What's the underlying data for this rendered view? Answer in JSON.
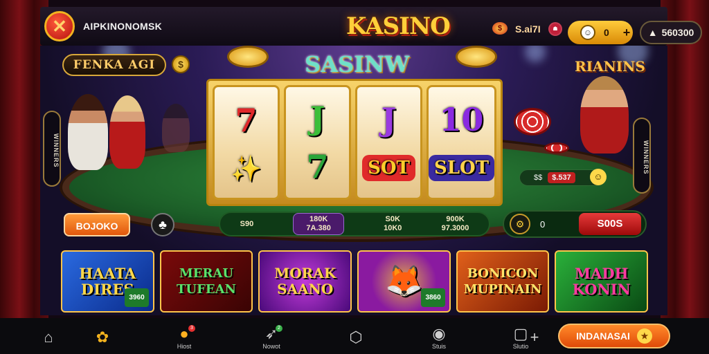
{
  "header": {
    "app_name": "AIPKINONOMSK",
    "brand": "KASINO",
    "slot_value": "S.ai7I",
    "coins_value": "0",
    "coins_plus": "+",
    "balance": "560300",
    "balance_icon": "wallet-icon"
  },
  "stage": {
    "title_label": "FENKA AGI",
    "reel_title": "SASINW",
    "winners_label": "RIANINS",
    "left_pill": "WINNERS",
    "right_pill": "WINNERS",
    "reels": [
      {
        "top": "7",
        "bottom": "✨"
      },
      {
        "top": "J",
        "bottom": "7"
      },
      {
        "top": "J",
        "bottom": "SOT"
      },
      {
        "top": "10",
        "bottom": "SLOT"
      }
    ],
    "dealer_pill_prefix": "$$",
    "dealer_pill_amount": "$.537",
    "bet_button": "BOJOKO",
    "info_cells": [
      {
        "line1": "S90",
        "line2": ""
      },
      {
        "line1": "180K",
        "line2": "7A.380"
      },
      {
        "line1": "S0K",
        "line2": "10K0"
      },
      {
        "line1": "900K",
        "line2": "97.3000"
      }
    ],
    "spin_value": "0",
    "spin_button": "S00S"
  },
  "games": [
    {
      "title": "HAATA DIRES",
      "badge": "3960"
    },
    {
      "title": "MERAU TUFEAN",
      "badge": ""
    },
    {
      "title": "MORAK SAANO",
      "badge": ""
    },
    {
      "title": "",
      "badge": "3860"
    },
    {
      "title": "BONICON MUPINAIN",
      "badge": ""
    },
    {
      "title": "MADH KONIN",
      "badge": ""
    }
  ],
  "bottom_nav": [
    {
      "label": "",
      "icon": "home-icon"
    },
    {
      "label": "",
      "icon": "puzzle-icon"
    },
    {
      "label": "Hiost",
      "icon": "coin-icon",
      "badge": "3"
    },
    {
      "label": "Nowot",
      "icon": "bird-icon",
      "badge": "2"
    },
    {
      "label": "",
      "icon": "cube-icon"
    },
    {
      "label": "Stuis",
      "icon": "chat-icon"
    },
    {
      "label": "Slutio",
      "icon": "bag-icon"
    }
  ],
  "cta": {
    "label": "INDANASAI",
    "icon": "star-icon"
  },
  "colors": {
    "accent_gold": "#ffcf3a",
    "felt_green": "#1c5f28",
    "cta_orange": "#e04a08"
  }
}
